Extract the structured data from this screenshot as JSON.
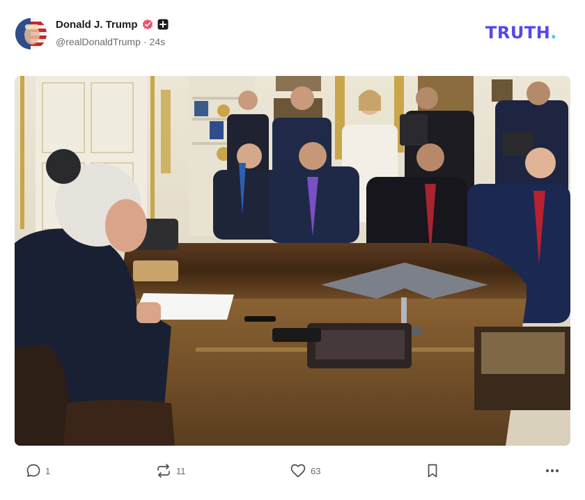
{
  "post": {
    "author": {
      "display_name": "Donald J. Trump",
      "handle": "@realDonaldTrump",
      "separator": "·",
      "timestamp": "24s",
      "avatar_icon": "avatar-flag",
      "verified_icon": "verified-badge-icon",
      "verified_color": "#f0506e"
    },
    "brand": {
      "logo_text": "TRUTH",
      "logo_dot": ".",
      "logo_color": "#5448ee",
      "dot_color": "#36d4c6"
    },
    "image": {
      "description_icon": "oval-office-photo"
    },
    "actions": {
      "replies": "1",
      "retruths": "11",
      "likes": "63"
    }
  }
}
